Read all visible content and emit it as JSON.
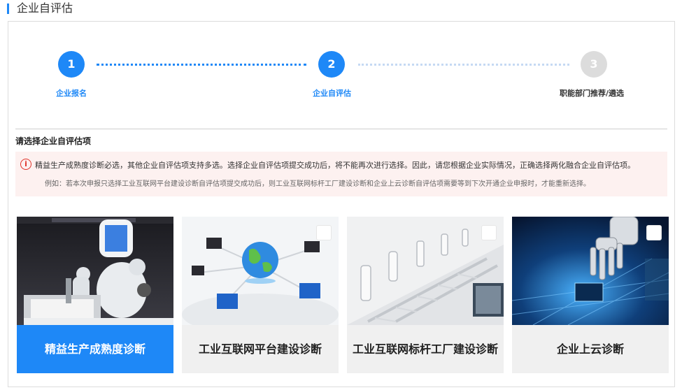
{
  "page": {
    "title": "企业自评估"
  },
  "steps": [
    {
      "number": "1",
      "label": "企业报名",
      "state": "done"
    },
    {
      "number": "2",
      "label": "企业自评估",
      "state": "current"
    },
    {
      "number": "3",
      "label": "职能部门推荐/遴选",
      "state": "pending"
    }
  ],
  "section": {
    "title": "请选择企业自评估项",
    "notice_line1": "精益生产成熟度诊断必选，其他企业自评估项支持多选。选择企业自评估项提交成功后，将不能再次进行选择。因此，请您根据企业实际情况，正确选择两化融合企业自评估项。",
    "notice_line2": "例如：若本次申报只选择工业互联网平台建设诊断自评估项提交成功后，则工业互联网标杆工厂建设诊断和企业上云诊断自评估项需要等到下次开通企业申报时，才能重新选择。"
  },
  "cards": [
    {
      "label": "精益生产成熟度诊断",
      "selected": true,
      "image": "robot-icon"
    },
    {
      "label": "工业互联网平台建设诊断",
      "selected": false,
      "image": "network-globe-icon"
    },
    {
      "label": "工业互联网标杆工厂建设诊断",
      "selected": false,
      "image": "factory-robot-arms-icon"
    },
    {
      "label": "企业上云诊断",
      "selected": false,
      "image": "robot-hand-chip-icon"
    }
  ],
  "colors": {
    "accent": "#1e88f7",
    "inactive": "#dcdcdc",
    "warn": "#e0332a",
    "notice_bg": "#fdf1f0"
  }
}
